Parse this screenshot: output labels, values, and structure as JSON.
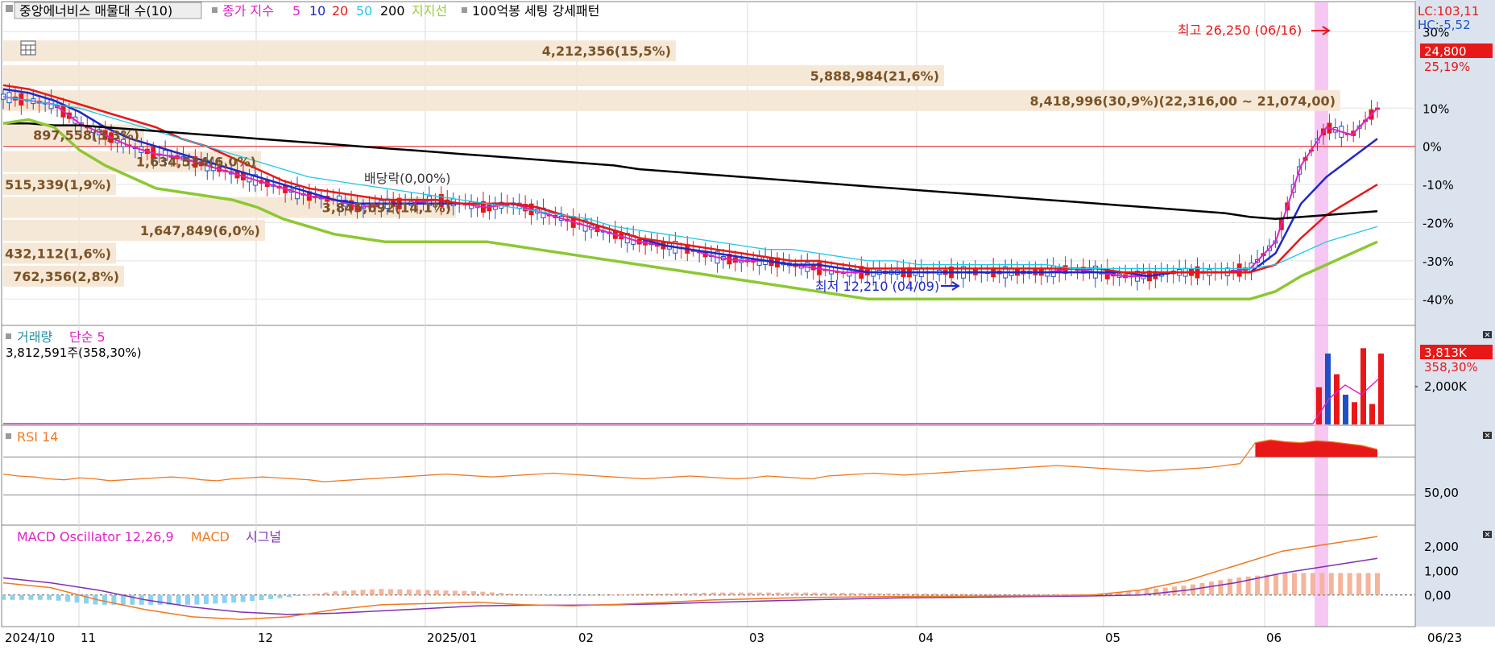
{
  "header": {
    "stock_name": "중앙에너비스 매물대 수(10)",
    "ma_label": "종가 지수",
    "ma_periods": [
      "5",
      "10",
      "20",
      "50",
      "200"
    ],
    "support_label": "지지선",
    "pattern_label": "100억봉 세팅 강세패턴"
  },
  "corner": {
    "lc": "LC:103,11",
    "hc": "HC:-5,52",
    "price_badge": "24,800",
    "pct_badge": "25,19%"
  },
  "colors": {
    "ma5": "#e020c8",
    "ma10": "#1e28c8",
    "ma20": "#e81818",
    "ma50": "#20c8e8",
    "ma200": "#000000",
    "support": "#8cc832",
    "up": "#e81818",
    "down": "#1e50c8",
    "highlight": "#f4b4f0",
    "zone": "#f5e6d2",
    "rsi": "#f07820",
    "macd": "#f07820",
    "signal": "#8030b0",
    "osc_pos": "#f5b49c",
    "osc_neg": "#8cd2f0"
  },
  "annotations": {
    "high": "최고 26,250 (06/16)",
    "low": "최저 12,210 (04/09)",
    "dividend": "배당락(0,00%)"
  },
  "chart_data": [
    {
      "type": "candlestick",
      "name": "price",
      "y_unit": "%",
      "ylim": [
        -45,
        32
      ],
      "y_ticks": [
        "30%",
        "10%",
        "0%",
        "-10%",
        "-20%",
        "-30%",
        "-40%"
      ],
      "y_tick_values": [
        30,
        10,
        0,
        -10,
        -20,
        -30,
        -40
      ],
      "x_ticks": [
        "2024/10",
        "11",
        "12",
        "2025/01",
        "02",
        "03",
        "04",
        "05",
        "06",
        "06/23"
      ],
      "volume_profile": [
        {
          "label": "4,212,356(15,5%)",
          "price_pct": 25
        },
        {
          "label": "5,888,984(21,6%)",
          "price_pct": 18.5
        },
        {
          "label": "8,418,996(30,9%)(22,316,00 ~ 21,074,00)",
          "price_pct": 12
        },
        {
          "label": "897,558(3,3%)",
          "price_pct": 3
        },
        {
          "label": "1,634,534(6,0%)",
          "price_pct": -4
        },
        {
          "label": "515,339(1,9%)",
          "price_pct": -10
        },
        {
          "label": "3,845,692(14,1%)",
          "price_pct": -16
        },
        {
          "label": "1,647,849(6,0%)",
          "price_pct": -22
        },
        {
          "label": "432,112(1,6%)",
          "price_pct": -28
        },
        {
          "label": "762,356(2,8%)",
          "price_pct": -34
        }
      ],
      "series": [
        {
          "name": "5",
          "values": [
            13,
            12,
            11,
            6,
            3,
            0,
            -2,
            -3,
            -5,
            -7,
            -9,
            -11,
            -13,
            -14,
            -16,
            -15,
            -15,
            -14,
            -15,
            -16,
            -15,
            -17,
            -19,
            -21,
            -23,
            -25,
            -26,
            -27,
            -29,
            -30,
            -30,
            -31,
            -32,
            -33,
            -33,
            -33,
            -33,
            -33,
            -33,
            -33,
            -33,
            -33,
            -32,
            -33,
            -34,
            -34,
            -33,
            -33,
            -33,
            -32,
            -25,
            -5,
            5,
            3,
            10
          ]
        },
        {
          "name": "10",
          "values": [
            15,
            14,
            12,
            9,
            5,
            2,
            0,
            -2,
            -4,
            -6,
            -8,
            -10,
            -12,
            -14,
            -15,
            -15,
            -15,
            -15,
            -15,
            -15,
            -15,
            -16,
            -18,
            -20,
            -22,
            -24,
            -26,
            -27,
            -28,
            -29,
            -30,
            -31,
            -31,
            -32,
            -33,
            -33,
            -33,
            -33,
            -33,
            -33,
            -33,
            -33,
            -33,
            -33,
            -33,
            -34,
            -33,
            -33,
            -33,
            -33,
            -28,
            -15,
            -8,
            -3,
            2
          ]
        },
        {
          "name": "20",
          "values": [
            16,
            15,
            13,
            11,
            9,
            7,
            5,
            2,
            0,
            -3,
            -6,
            -9,
            -11,
            -12,
            -13,
            -14,
            -14,
            -14,
            -15,
            -15,
            -15,
            -16,
            -18,
            -20,
            -22,
            -24,
            -25,
            -26,
            -27,
            -28,
            -29,
            -30,
            -30,
            -31,
            -32,
            -32,
            -32,
            -32,
            -32,
            -32,
            -32,
            -32,
            -32,
            -32,
            -33,
            -33,
            -33,
            -33,
            -33,
            -33,
            -31,
            -24,
            -18,
            -14,
            -10
          ]
        },
        {
          "name": "50",
          "values": [
            13,
            12,
            11,
            10,
            8,
            6,
            4,
            2,
            0,
            -2,
            -4,
            -6,
            -8,
            -9,
            -10,
            -11,
            -12,
            -13,
            -14,
            -15,
            -16,
            -17,
            -18,
            -19,
            -21,
            -22,
            -23,
            -24,
            -25,
            -26,
            -27,
            -27,
            -28,
            -29,
            -30,
            -30,
            -31,
            -31,
            -31,
            -31,
            -31,
            -31,
            -32,
            -32,
            -32,
            -32,
            -32,
            -32,
            -32,
            -32,
            -31,
            -28,
            -25,
            -23,
            -21
          ]
        },
        {
          "name": "200",
          "values": [
            6,
            6,
            5.5,
            5.5,
            5,
            4.5,
            4,
            3.5,
            3,
            2.5,
            2,
            1.5,
            1,
            0.5,
            0,
            -0.5,
            -1,
            -1.5,
            -2,
            -2.5,
            -3,
            -3.5,
            -4,
            -4.5,
            -5,
            -6,
            -6.5,
            -7,
            -7.5,
            -8,
            -8.5,
            -9,
            -9.5,
            -10,
            -10.5,
            -11,
            -11.5,
            -12,
            -12.5,
            -13,
            -13.5,
            -14,
            -14.5,
            -15,
            -15.5,
            -16,
            -16.5,
            -17,
            -17.5,
            -18.5,
            -19,
            -18.5,
            -18,
            -17.5,
            -17
          ]
        },
        {
          "name": "지지선",
          "values": [
            6,
            7,
            5,
            -1,
            -5,
            -8,
            -11,
            -12,
            -13,
            -14,
            -16,
            -19,
            -21,
            -23,
            -24,
            -25,
            -25,
            -25,
            -25,
            -25,
            -26,
            -27,
            -28,
            -29,
            -30,
            -31,
            -32,
            -33,
            -34,
            -35,
            -36,
            -37,
            -38,
            -39,
            -40,
            -40,
            -40,
            -40,
            -40,
            -40,
            -40,
            -40,
            -40,
            -40,
            -40,
            -40,
            -40,
            -40,
            -40,
            -40,
            -38,
            -34,
            -31,
            -28,
            -25
          ]
        }
      ]
    },
    {
      "type": "bar",
      "name": "volume",
      "title": "거래량",
      "ma_label": "단순 5",
      "current": "3,812,591주(358,30%)",
      "y_ticks": [
        "2,000K"
      ],
      "current_badge": "3,813K",
      "current_pct": "358,30%",
      "values_k": [
        2000,
        3813,
        2700,
        1600,
        1200,
        4100,
        1100,
        3813
      ]
    },
    {
      "type": "line",
      "name": "rsi",
      "title": "RSI 14",
      "y_ticks": [
        "50,00"
      ],
      "ylim": [
        0,
        100
      ],
      "values": [
        52,
        50,
        49,
        47,
        46,
        48,
        47,
        45,
        46,
        47,
        48,
        49,
        48,
        46,
        45,
        47,
        48,
        49,
        48,
        47,
        46,
        44,
        45,
        46,
        47,
        48,
        49,
        50,
        51,
        52,
        51,
        50,
        49,
        50,
        51,
        52,
        53,
        52,
        51,
        50,
        49,
        48,
        47,
        48,
        49,
        50,
        49,
        48,
        47,
        48,
        50,
        49,
        48,
        47,
        50,
        51,
        52,
        53,
        52,
        51,
        52,
        53,
        54,
        55,
        56,
        57,
        58,
        59,
        60,
        61,
        60,
        59,
        58,
        57,
        56,
        55,
        56,
        57,
        58,
        59,
        61,
        63,
        85,
        88,
        86,
        85,
        87,
        86,
        84,
        82,
        78
      ]
    },
    {
      "type": "line",
      "name": "macd",
      "title": "MACD Oscillator 12,26,9",
      "macd_label": "MACD",
      "signal_label": "시그널",
      "y_ticks": [
        "2,000",
        "1,000",
        "0,00"
      ],
      "y_tick_values": [
        2000,
        1000,
        0
      ],
      "ylim": [
        -1100,
        2600
      ],
      "macd_values": [
        500,
        300,
        -200,
        -600,
        -900,
        -1000,
        -900,
        -600,
        -400,
        -350,
        -300,
        -400,
        -450,
        -380,
        -300,
        -200,
        -150,
        -100,
        -80,
        -60,
        -50,
        -40,
        -30,
        0,
        200,
        600,
        1200,
        1800,
        2100,
        2400
      ],
      "signal_values": [
        700,
        500,
        200,
        -200,
        -500,
        -700,
        -800,
        -750,
        -650,
        -550,
        -450,
        -420,
        -420,
        -400,
        -360,
        -300,
        -250,
        -200,
        -160,
        -120,
        -100,
        -80,
        -60,
        -40,
        0,
        200,
        500,
        900,
        1200,
        1500
      ],
      "osc_values": [
        -200,
        -200,
        -400,
        -400,
        -400,
        -300,
        -100,
        150,
        250,
        200,
        150,
        20,
        -30,
        20,
        60,
        100,
        100,
        100,
        80,
        60,
        50,
        40,
        30,
        40,
        200,
        400,
        700,
        900,
        900,
        900
      ]
    }
  ]
}
